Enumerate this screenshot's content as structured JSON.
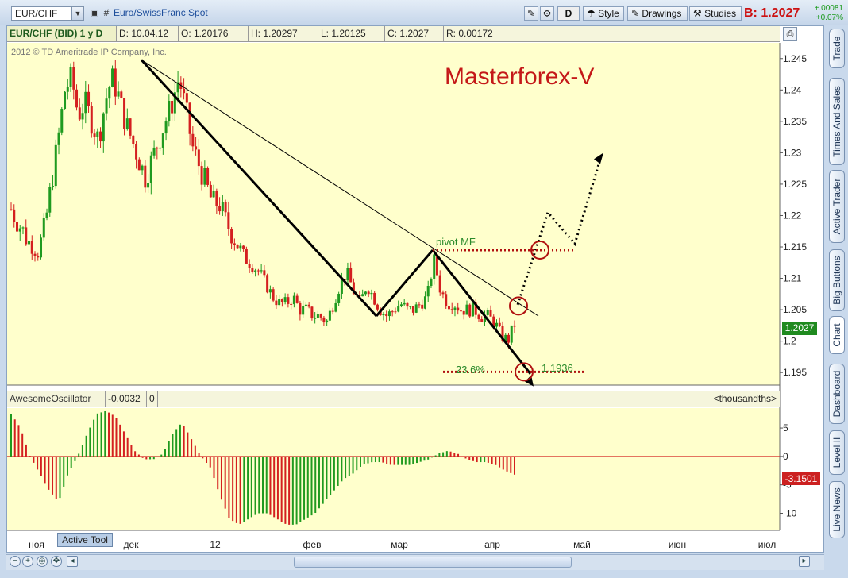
{
  "toolbar": {
    "symbol": "EUR/CHF",
    "description": "Euro/SwissFranc Spot",
    "d_button": "D",
    "style_label": "Style",
    "drawings_label": "Drawings",
    "studies_label": "Studies",
    "bid_label": "B: 1.2027",
    "change_abs": "+.00081",
    "change_pct": "+0.07%"
  },
  "info": {
    "title": "EUR/CHF (BID) 1 y D",
    "date": "D: 10.04.12",
    "open": "O: 1.20176",
    "high": "H: 1.20297",
    "low": "L: 1.20125",
    "close": "C: 1.2027",
    "range": "R: 0.00172"
  },
  "copyright": "2012 © TD Ameritrade IP Company, Inc.",
  "watermark": "Masterforex-V",
  "oscillator": {
    "name": "AwesomeOscillator",
    "value": "-0.0032",
    "value2": "0",
    "units": "<thousandths>",
    "last_badge": "-3.1501"
  },
  "price_badge": "1.2027",
  "annotations": {
    "pivot": "pivot MF",
    "fib": "23.6%",
    "target": "1.1936"
  },
  "sidebar_tabs": [
    "Trade",
    "Times And Sales",
    "Active Trader",
    "Big Buttons",
    "Chart",
    "Dashboard",
    "Level II",
    "Live News"
  ],
  "bottom": {
    "active_tool": "Active Tool"
  },
  "colors": {
    "up": "#1f9a1f",
    "down": "#d41f1f",
    "bg": "#ffffcc",
    "drawing": "#000000",
    "levels": "#b01010"
  },
  "chart_data": [
    {
      "type": "candlestick",
      "title": "EUR/CHF (BID) 1 y D",
      "x_labels": [
        "ноя",
        "дек",
        "12",
        "фев",
        "мар",
        "апр",
        "май",
        "июн",
        "июл"
      ],
      "ylim": [
        1.193,
        1.2475
      ],
      "y_ticks": [
        1.245,
        1.24,
        1.235,
        1.23,
        1.225,
        1.22,
        1.215,
        1.21,
        1.205,
        1.2,
        1.195
      ],
      "y_tick_labels": [
        "1.245",
        "1.24",
        "1.235",
        "1.23",
        "1.225",
        "1.22",
        "1.215",
        "1.21",
        "1.205",
        "1.2",
        "1.195"
      ],
      "close_path": [
        1.221,
        1.219,
        1.217,
        1.215,
        1.214,
        1.218,
        1.225,
        1.232,
        1.24,
        1.242,
        1.236,
        1.238,
        1.235,
        1.232,
        1.238,
        1.242,
        1.239,
        1.235,
        1.232,
        1.229,
        1.226,
        1.229,
        1.232,
        1.235,
        1.238,
        1.242,
        1.237,
        1.231,
        1.228,
        1.225,
        1.222,
        1.222,
        1.219,
        1.217,
        1.215,
        1.213,
        1.212,
        1.211,
        1.209,
        1.207,
        1.206,
        1.206,
        1.207,
        1.205,
        1.205,
        1.204,
        1.204,
        1.203,
        1.206,
        1.209,
        1.211,
        1.208,
        1.206,
        1.209,
        1.207,
        1.205,
        1.204,
        1.205,
        1.206,
        1.205,
        1.205,
        1.206,
        1.207,
        1.213,
        1.208,
        1.206,
        1.206,
        1.205,
        1.205,
        1.205,
        1.204,
        1.204,
        1.203,
        1.201,
        1.2,
        1.2027
      ],
      "levels": [
        {
          "label": "pivot MF",
          "value": 1.2145
        },
        {
          "label": "1.1936",
          "value": 1.1951
        }
      ],
      "last": 1.2027
    },
    {
      "type": "bar",
      "title": "AwesomeOscillator",
      "y_ticks": [
        5,
        0,
        -5,
        -10
      ],
      "ylim": [
        -13,
        8.5
      ],
      "last": -3.1501
    }
  ]
}
